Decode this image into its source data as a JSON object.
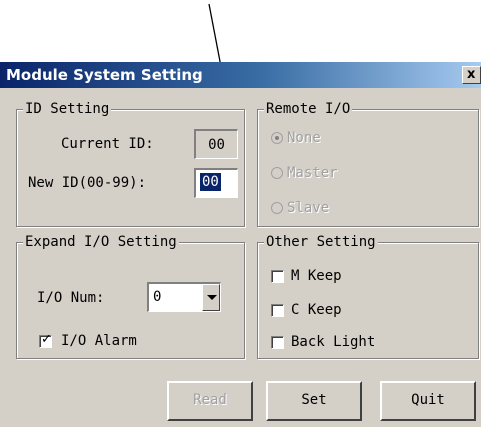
{
  "window": {
    "title": "Module System Setting",
    "close_label": "x"
  },
  "id_setting": {
    "legend": "ID Setting",
    "current_id_label": "Current ID:",
    "current_id_value": "00",
    "new_id_label": "New ID(00-99):",
    "new_id_value": "00"
  },
  "remote_io": {
    "legend": "Remote I/O",
    "options": [
      "None",
      "Master",
      "Slave"
    ],
    "selected": "None"
  },
  "expand_io": {
    "legend": "Expand I/O Setting",
    "io_num_label": "I/O Num:",
    "io_num_value": "0",
    "io_alarm_label": "I/O Alarm",
    "io_alarm_checked": true
  },
  "other_setting": {
    "legend": "Other Setting",
    "m_keep_label": "M Keep",
    "c_keep_label": "C Keep",
    "back_light_label": "Back Light"
  },
  "buttons": {
    "read_label": "Read",
    "set_label": "Set",
    "quit_label": "Quit"
  }
}
